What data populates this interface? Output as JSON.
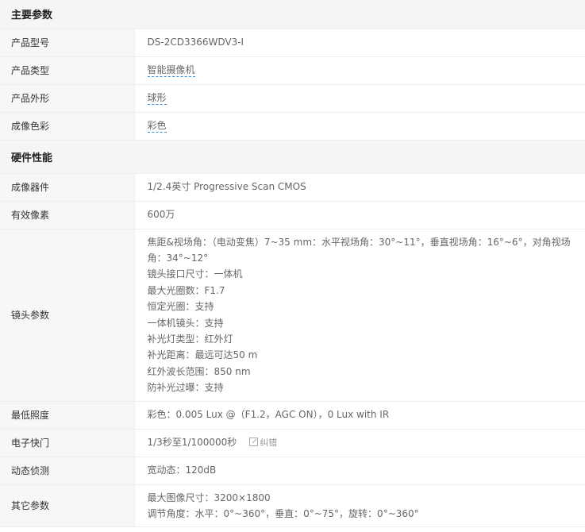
{
  "sections": [
    {
      "title": "主要参数",
      "rows": [
        {
          "label": "产品型号",
          "lines": [
            "DS-2CD3366WDV3-I"
          ],
          "link": false
        },
        {
          "label": "产品类型",
          "lines": [
            "智能摄像机"
          ],
          "link": true
        },
        {
          "label": "产品外形",
          "lines": [
            "球形"
          ],
          "link": true
        },
        {
          "label": "成像色彩",
          "lines": [
            "彩色"
          ],
          "link": true
        }
      ]
    },
    {
      "title": "硬件性能",
      "rows": [
        {
          "label": "成像器件",
          "lines": [
            "1/2.4英寸 Progressive Scan CMOS"
          ]
        },
        {
          "label": "有效像素",
          "lines": [
            "600万"
          ]
        },
        {
          "label": "镜头参数",
          "lines": [
            "焦距&视场角：（电动变焦）7~35 mm：水平视场角：30°~11°，垂直视场角：16°~6°，对角视场角：34°~12°",
            "镜头接口尺寸：一体机",
            "最大光圈数：F1.7",
            "恒定光圈：支持",
            "一体机镜头：支持",
            "补光灯类型：红外灯",
            "补光距离：最远可达50 m",
            "红外波长范围：850 nm",
            "防补光过曝：支持"
          ]
        },
        {
          "label": "最低照度",
          "lines": [
            "彩色：0.005 Lux @（F1.2，AGC ON），0 Lux with IR"
          ]
        },
        {
          "label": "电子快门",
          "lines": [
            "1/3秒至1/100000秒"
          ],
          "report": "纠错"
        },
        {
          "label": "动态侦测",
          "lines": [
            "宽动态：120dB"
          ]
        },
        {
          "label": "其它参数",
          "lines": [
            "最大图像尺寸：3200×1800",
            "调节角度：水平：0°~360°，垂直：0°~75°，旋转：0°~360°"
          ]
        }
      ]
    }
  ]
}
